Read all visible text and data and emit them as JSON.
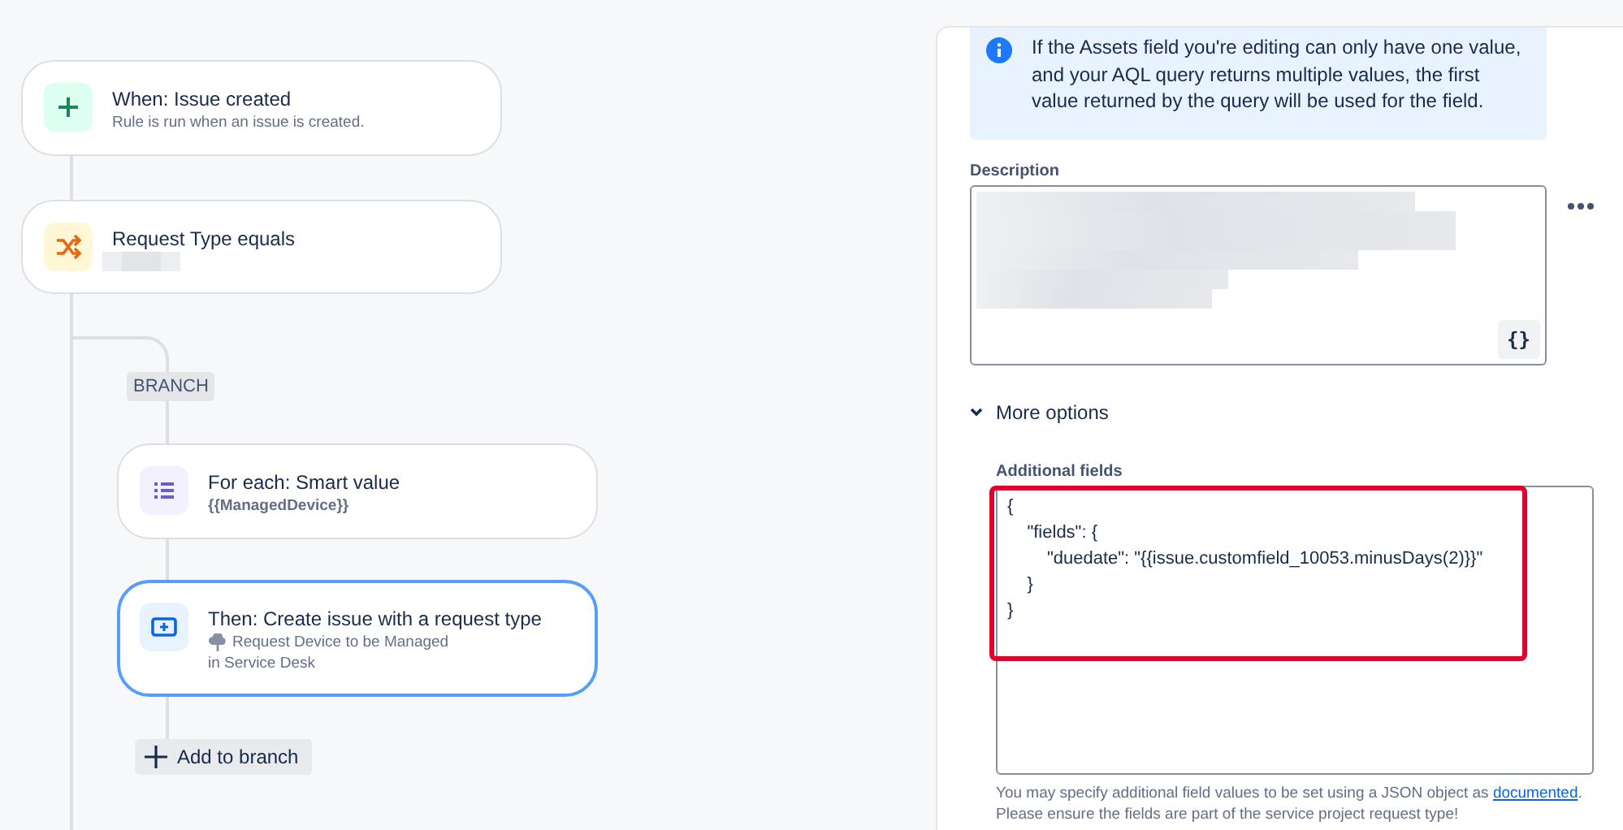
{
  "flow": {
    "trigger": {
      "kind": "plus",
      "title": "When: Issue created",
      "subtitle": "Rule is run when an issue is created.",
      "selected": false
    },
    "condition": {
      "kind": "shuffle",
      "title": "Request Type equals",
      "redacted": true,
      "selected": false
    },
    "branch": {
      "tag": "BRANCH",
      "steps": [
        {
          "kind": "list",
          "title": "For each: Smart value",
          "subtitle": "{{ManagedDevice}}",
          "selected": false
        },
        {
          "kind": "create",
          "title": "Then: Create issue with a request type",
          "subtitle": "Request Device to be Managed",
          "subtitle_2": "in Service Desk",
          "selected": true
        }
      ],
      "add_button": "Add to branch"
    }
  },
  "panel": {
    "info": "If the Assets field you're editing can only have one value, and your AQL query returns multiple values, the first value returned by the query will be used for the field.",
    "description": {
      "label": "Description",
      "redacted": true,
      "smart_button": "{}"
    },
    "more_options": {
      "label": "More options",
      "expanded": true
    },
    "additional_fields": {
      "label": "Additional fields",
      "value": "{\n    \"fields\": {\n        \"duedate\": \"{{issue.customfield_10053.minusDays(2)}}\"\n    }\n}",
      "highlighted": true,
      "help": "You may specify additional field values to be set using a JSON object as ",
      "help_link": "documented",
      "help_end": ". Please ensure the fields are part of the service project request type!"
    }
  }
}
